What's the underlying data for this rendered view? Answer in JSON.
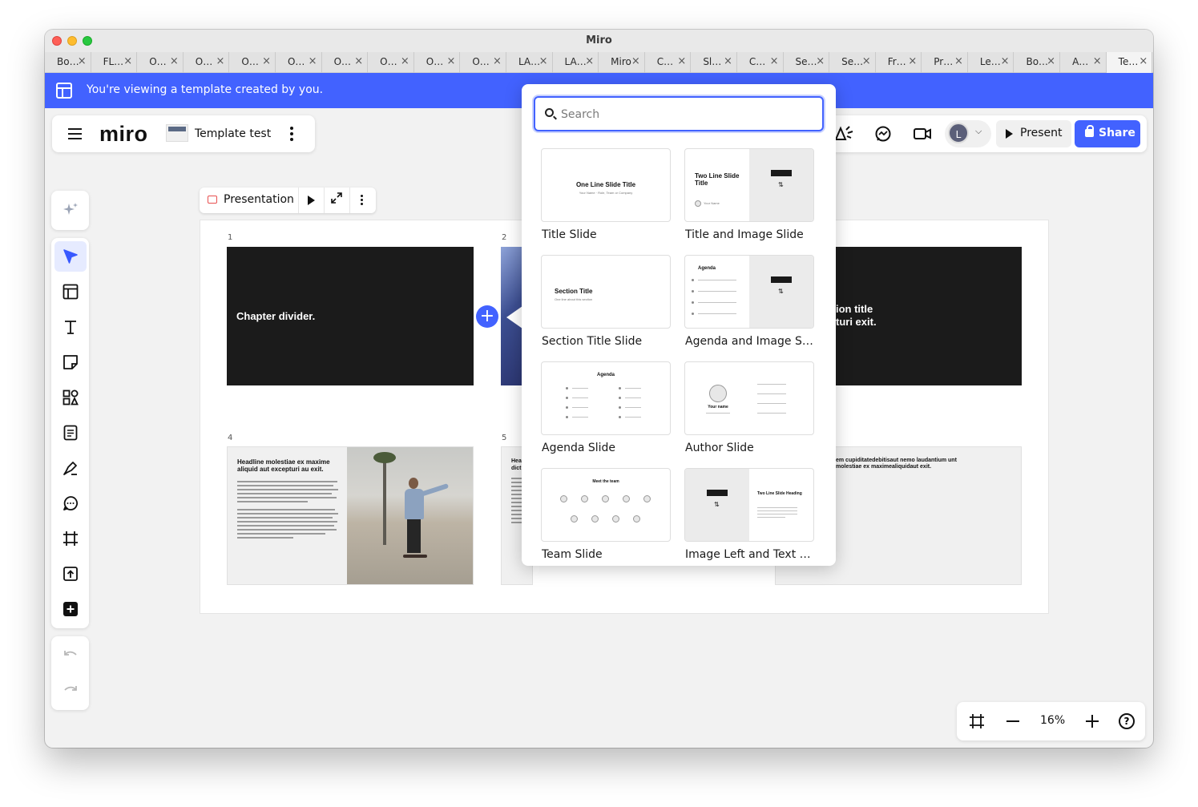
{
  "window": {
    "title": "Miro"
  },
  "tabs": [
    "Bo…",
    "FL…",
    "O…",
    "O…",
    "O…",
    "O…",
    "O…",
    "O…",
    "O…",
    "O…",
    "LA…",
    "LA…",
    "Miro",
    "C…",
    "Sl…",
    "C…",
    "Se…",
    "Se…",
    "Fr…",
    "Pr…",
    "Le…",
    "Bo…",
    "A…",
    "Te…"
  ],
  "active_tab_index": 23,
  "banner": {
    "text": "You're viewing a template created by you."
  },
  "board": {
    "logo": "miro",
    "name": "Template test"
  },
  "topbar": {
    "present_label": "Present",
    "share_label": "Share",
    "avatar_initial": "L"
  },
  "presentation_bar": {
    "label": "Presentation"
  },
  "slides": [
    {
      "num": "1",
      "title": "Chapter divider."
    },
    {
      "num": "2"
    },
    {
      "title_partial": "ion title\nturi exit."
    },
    {
      "num": "4",
      "headline": "Headline molestiae ex maxime aliquid aut excepturi au exit."
    },
    {
      "num": "5",
      "headline_partial": "Hea dict"
    },
    {
      "text_partial": "em cupiditatedebitisaut nemo laudantium unt molestiae ex maximealiquidaut exit."
    }
  ],
  "search": {
    "placeholder": "Search",
    "value": ""
  },
  "templates": [
    {
      "label": "Title Slide",
      "thumb_title": "One Line Slide Title",
      "thumb_sub": "Your Name · Role, Team or Company"
    },
    {
      "label": "Title and Image Slide",
      "thumb_title": "Two Line Slide Title",
      "thumb_sub": "Your Name"
    },
    {
      "label": "Section Title Slide",
      "thumb_title": "Section Title",
      "thumb_sub": "One line about this section"
    },
    {
      "label": "Agenda and Image Sli…",
      "thumb_title": "Agenda"
    },
    {
      "label": "Agenda Slide",
      "thumb_title": "Agenda"
    },
    {
      "label": "Author Slide",
      "thumb_title": "Your name"
    },
    {
      "label": "Team Slide",
      "thumb_title": "Meet the team"
    },
    {
      "label": "Image Left and Text Ri…",
      "thumb_title": "Two Line Slide Heading"
    }
  ],
  "zoom": {
    "value": "16%"
  },
  "colors": {
    "accent": "#4262ff",
    "banner": "#4262ff",
    "slide_dark": "#1b1b1b"
  },
  "icons": [
    "banner-template-icon",
    "hamburger-icon",
    "kebab-icon",
    "ai-sparkle-icon",
    "select-cursor-icon",
    "templates-icon",
    "text-icon",
    "sticky-note-icon",
    "shapes-icon",
    "doc-icon",
    "pen-icon",
    "comment-icon",
    "frame-icon",
    "upload-icon",
    "more-tools-icon",
    "undo-icon",
    "redo-icon",
    "reactions-icon",
    "chat-icon",
    "video-icon",
    "play-icon",
    "lock-icon",
    "search-icon",
    "plus-icon",
    "fit-frame-icon",
    "zoom-out-icon",
    "zoom-in-icon",
    "help-icon"
  ]
}
